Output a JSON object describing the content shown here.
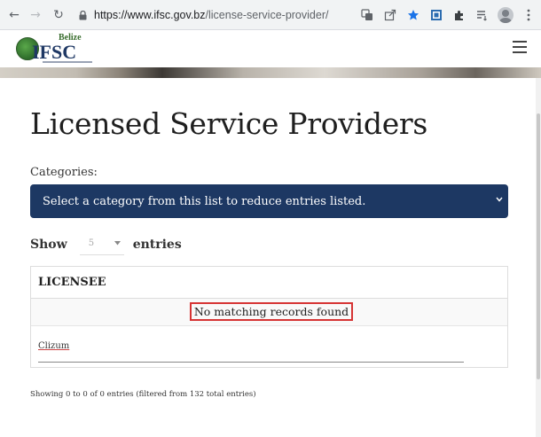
{
  "browser": {
    "url_host": "https://www.ifsc.gov.bz",
    "url_path": "/license-service-provider/",
    "back_glyph": "←",
    "forward_glyph": "→",
    "reload_glyph": "↻",
    "icons": [
      "translate-icon",
      "share-icon",
      "bookmark-star-icon",
      "screenshot-icon",
      "extensions-icon",
      "reading-list-icon",
      "profile-avatar-icon",
      "kebab-menu-icon"
    ],
    "accent": "#1a73e8"
  },
  "header": {
    "logo_top": "Belize",
    "logo_main": "IFSC"
  },
  "main": {
    "title": "Licensed Service Providers",
    "categories_label": "Categories:",
    "category_select_text": "Select a category from this list to reduce entries listed.",
    "select_color": "#1d3863",
    "show_label": "Show",
    "entries_value": "5",
    "entries_label": "entries"
  },
  "table": {
    "header_licensee": "LICENSEE",
    "empty_message": "No matching records found",
    "filter_value": "Clizum",
    "highlight_color": "#d63434"
  },
  "info": {
    "text": "Showing 0 to 0 of 0 entries (filtered from 132 total entries)"
  }
}
